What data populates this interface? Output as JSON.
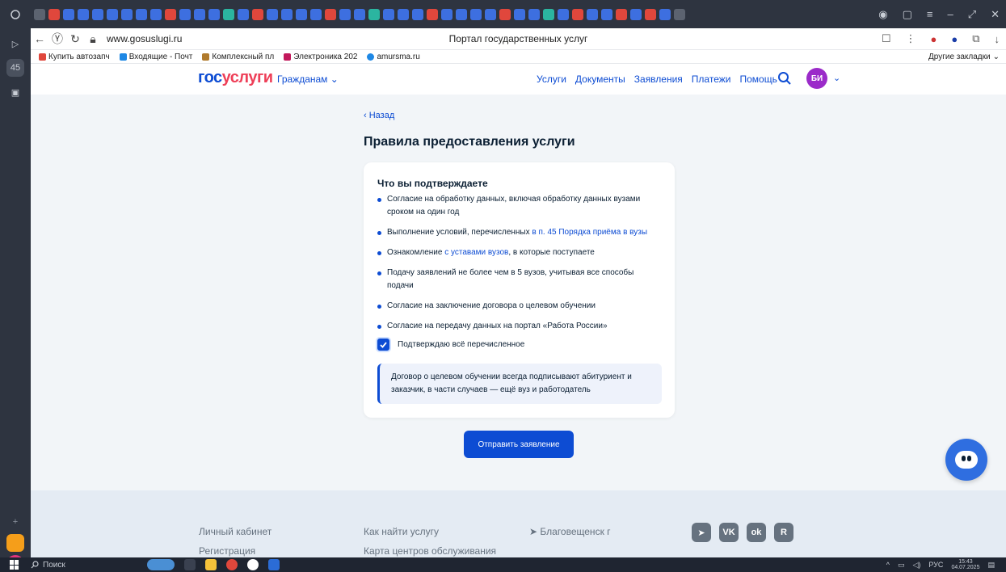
{
  "browser": {
    "url": "www.gosuslugi.ru",
    "tab_title": "Портал государственных услуг",
    "bookmarks": [
      "Купить автозапч",
      "Входящие - Почт",
      "Комплексный пл",
      "Электроника 202",
      "amursma.ru"
    ],
    "other_bookmarks": "Другие закладки"
  },
  "header": {
    "logo_part1": "гос",
    "logo_part2": "услуги",
    "citizens": "Гражданам",
    "nav": [
      "Услуги",
      "Документы",
      "Заявления",
      "Платежи",
      "Помощь"
    ],
    "avatar_initials": "БИ"
  },
  "main": {
    "back_label": "Назад",
    "title": "Правила предоставления услуги",
    "card_title": "Что вы подтверждаете",
    "items": [
      {
        "text_before": "Согласие на обработку данных, включая обработку данных вузами сроком на один год",
        "link": "",
        "text_after": ""
      },
      {
        "text_before": "Выполнение условий, перечисленных ",
        "link": "в п. 45 Порядка приёма в вузы",
        "text_after": ""
      },
      {
        "text_before": "Ознакомление ",
        "link": "с уставами вузов",
        "text_after": ", в которые поступаете"
      },
      {
        "text_before": "Подачу заявлений не более чем в 5 вузов, учитывая все способы подачи",
        "link": "",
        "text_after": ""
      },
      {
        "text_before": "Согласие на заключение договора о целевом обучении",
        "link": "",
        "text_after": ""
      },
      {
        "text_before": "Согласие на передачу данных на портал «Работа России»",
        "link": "",
        "text_after": ""
      }
    ],
    "checkbox_label": "Подтверждаю всё перечисленное",
    "checkbox_checked": true,
    "info_text": "Договор о целевом обучении всегда подписывают абитуриент и заказчик, в части случаев — ещё вуз и работодатель",
    "submit_label": "Отправить заявление"
  },
  "footer": {
    "links": [
      "Личный кабинет",
      "Регистрация",
      "Как найти услугу",
      "Карта центров обслуживания"
    ],
    "location": "Благовещенск г",
    "social": [
      "tg",
      "VK",
      "ok",
      "R"
    ]
  },
  "taskbar": {
    "search_label": "Поиск",
    "lang": "РУС",
    "time": "15:43",
    "date": "04.07.2025"
  },
  "colors": {
    "brand_blue": "#0d4cd3",
    "brand_red": "#ee3f58",
    "page_bg": "#f2f5f8"
  }
}
